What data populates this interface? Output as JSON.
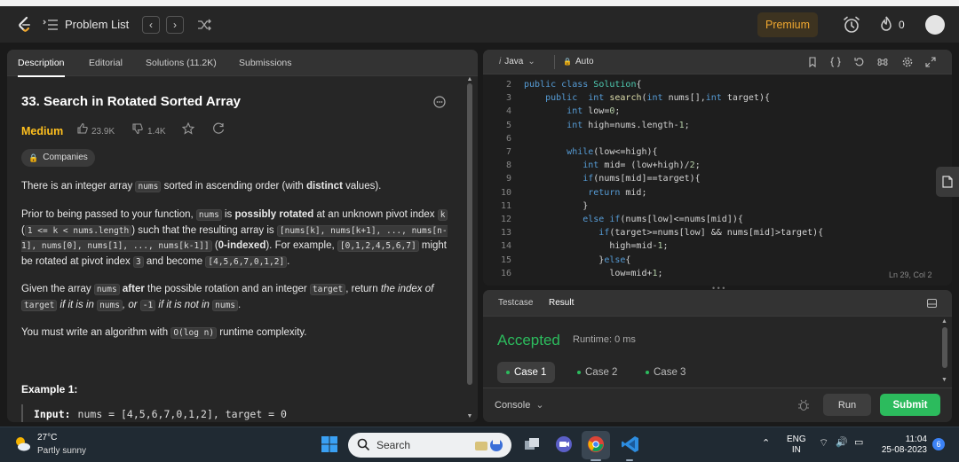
{
  "nav": {
    "title": "Problem List",
    "premium": "Premium",
    "streak": "0"
  },
  "left_tabs": [
    "Description",
    "Editorial",
    "Solutions (11.2K)",
    "Submissions"
  ],
  "problem": {
    "title": "33. Search in Rotated Sorted Array",
    "difficulty": "Medium",
    "likes": "23.9K",
    "dislikes": "1.4K",
    "companies": "Companies",
    "p1": {
      "a": "There is an integer array ",
      "c1": "nums",
      "b": " sorted in ascending order (with ",
      "bold": "distinct",
      "c": " values)."
    },
    "p2": {
      "a": "Prior to being passed to your function, ",
      "c1": "nums",
      "b": " is ",
      "bold1": "possibly rotated",
      "c": " at an unknown pivot index ",
      "c2": "k",
      "d": " (",
      "c3": "1 <= k < nums.length",
      "e": ") such that the resulting array is ",
      "c4": "[nums[k], nums[k+1], ..., nums[n-1], nums[0], nums[1], ..., nums[k-1]]",
      "f": " (",
      "bold2": "0-indexed",
      "g": "). For example, ",
      "c5": "[0,1,2,4,5,6,7]",
      "h": " might be rotated at pivot index ",
      "c6": "3",
      "i": " and become ",
      "c7": "[4,5,6,7,0,1,2]",
      "j": "."
    },
    "p3": {
      "a": "Given the array ",
      "c1": "nums",
      "bold": " after",
      "b": " the possible rotation and an integer ",
      "c2": "target",
      "c": ", return ",
      "it1": "the index of ",
      "c3": "target",
      "it2": " if it is in ",
      "c4": "nums",
      "it3": ", or ",
      "c5": "-1",
      "it4": " if it is not in ",
      "c6": "nums",
      "d": "."
    },
    "p4": {
      "a": "You must write an algorithm with ",
      "c1": "O(log n)",
      "b": " runtime complexity."
    },
    "example_title": "Example 1:",
    "example_input_label": "Input:",
    "example_input_value": "nums = [4,5,6,7,0,1,2], target = 0"
  },
  "editor": {
    "language": "Java",
    "mode": "Auto",
    "cursor": "Ln 29, Col 2",
    "lines": [
      {
        "n": "2",
        "t": "public class Solution{"
      },
      {
        "n": "3",
        "t": "    public  int search(int nums[],int target){"
      },
      {
        "n": "4",
        "t": "        int low=0;"
      },
      {
        "n": "5",
        "t": "        int high=nums.length-1;"
      },
      {
        "n": "6",
        "t": ""
      },
      {
        "n": "7",
        "t": "        while(low<=high){"
      },
      {
        "n": "8",
        "t": "           int mid= (low+high)/2;"
      },
      {
        "n": "9",
        "t": "           if(nums[mid]==target){"
      },
      {
        "n": "10",
        "t": "            return mid;"
      },
      {
        "n": "11",
        "t": "           }"
      },
      {
        "n": "12",
        "t": "           else if(nums[low]<=nums[mid]){"
      },
      {
        "n": "13",
        "t": "              if(target>=nums[low] && nums[mid]>target){"
      },
      {
        "n": "14",
        "t": "                high=mid-1;"
      },
      {
        "n": "15",
        "t": "              }else{"
      },
      {
        "n": "16",
        "t": "                low=mid+1;"
      }
    ]
  },
  "console": {
    "tabs": [
      "Testcase",
      "Result"
    ],
    "status": "Accepted",
    "runtime": "Runtime: 0 ms",
    "cases": [
      "Case 1",
      "Case 2",
      "Case 3"
    ],
    "console_label": "Console",
    "run": "Run",
    "submit": "Submit"
  },
  "taskbar": {
    "temp": "27°C",
    "weather": "Partly sunny",
    "search": "Search",
    "lang1": "ENG",
    "lang2": "IN",
    "time": "11:04",
    "date": "25-08-2023",
    "notif": "6"
  },
  "colors": {
    "accent_green": "#2cbb5d",
    "medium": "#ffc01e",
    "premium": "#f0a830"
  }
}
